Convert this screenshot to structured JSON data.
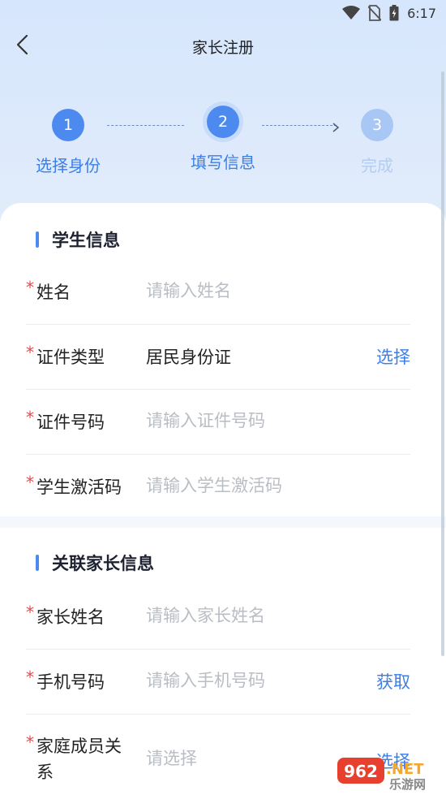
{
  "status_bar": {
    "time": "6:17",
    "icons": [
      "wifi-icon",
      "no-sim-icon",
      "battery-icon"
    ]
  },
  "header": {
    "title": "家长注册",
    "back_icon": "chevron-left-icon"
  },
  "steps": [
    {
      "number": "1",
      "label": "选择身份",
      "state": "done"
    },
    {
      "number": "2",
      "label": "填写信息",
      "state": "active"
    },
    {
      "number": "3",
      "label": "完成",
      "state": "pending"
    }
  ],
  "student_section": {
    "title": "学生信息",
    "fields": {
      "name": {
        "required": "*",
        "label": "姓名",
        "placeholder": "请输入姓名"
      },
      "id_type": {
        "required": "*",
        "label": "证件类型",
        "value": "居民身份证",
        "action": "选择"
      },
      "id_number": {
        "required": "*",
        "label": "证件号码",
        "placeholder": "请输入证件号码"
      },
      "activation_code": {
        "required": "*",
        "label": "学生激活码",
        "placeholder": "请输入学生激活码"
      }
    }
  },
  "parent_section": {
    "title": "关联家长信息",
    "fields": {
      "parent_name": {
        "required": "*",
        "label": "家长姓名",
        "placeholder": "请输入家长姓名"
      },
      "phone": {
        "required": "*",
        "label": "手机号码",
        "placeholder": "请输入手机号码",
        "action": "获取"
      },
      "relation": {
        "required": "*",
        "label": "家庭成员关系",
        "placeholder": "请选择",
        "action": "选择"
      }
    }
  },
  "watermark": {
    "text_top": "962.NET",
    "text_bottom": "乐游网"
  },
  "colors": {
    "accent": "#4d8af0",
    "link": "#3c7de6",
    "required": "#e94848",
    "step_pending": "#a9c7f5"
  }
}
